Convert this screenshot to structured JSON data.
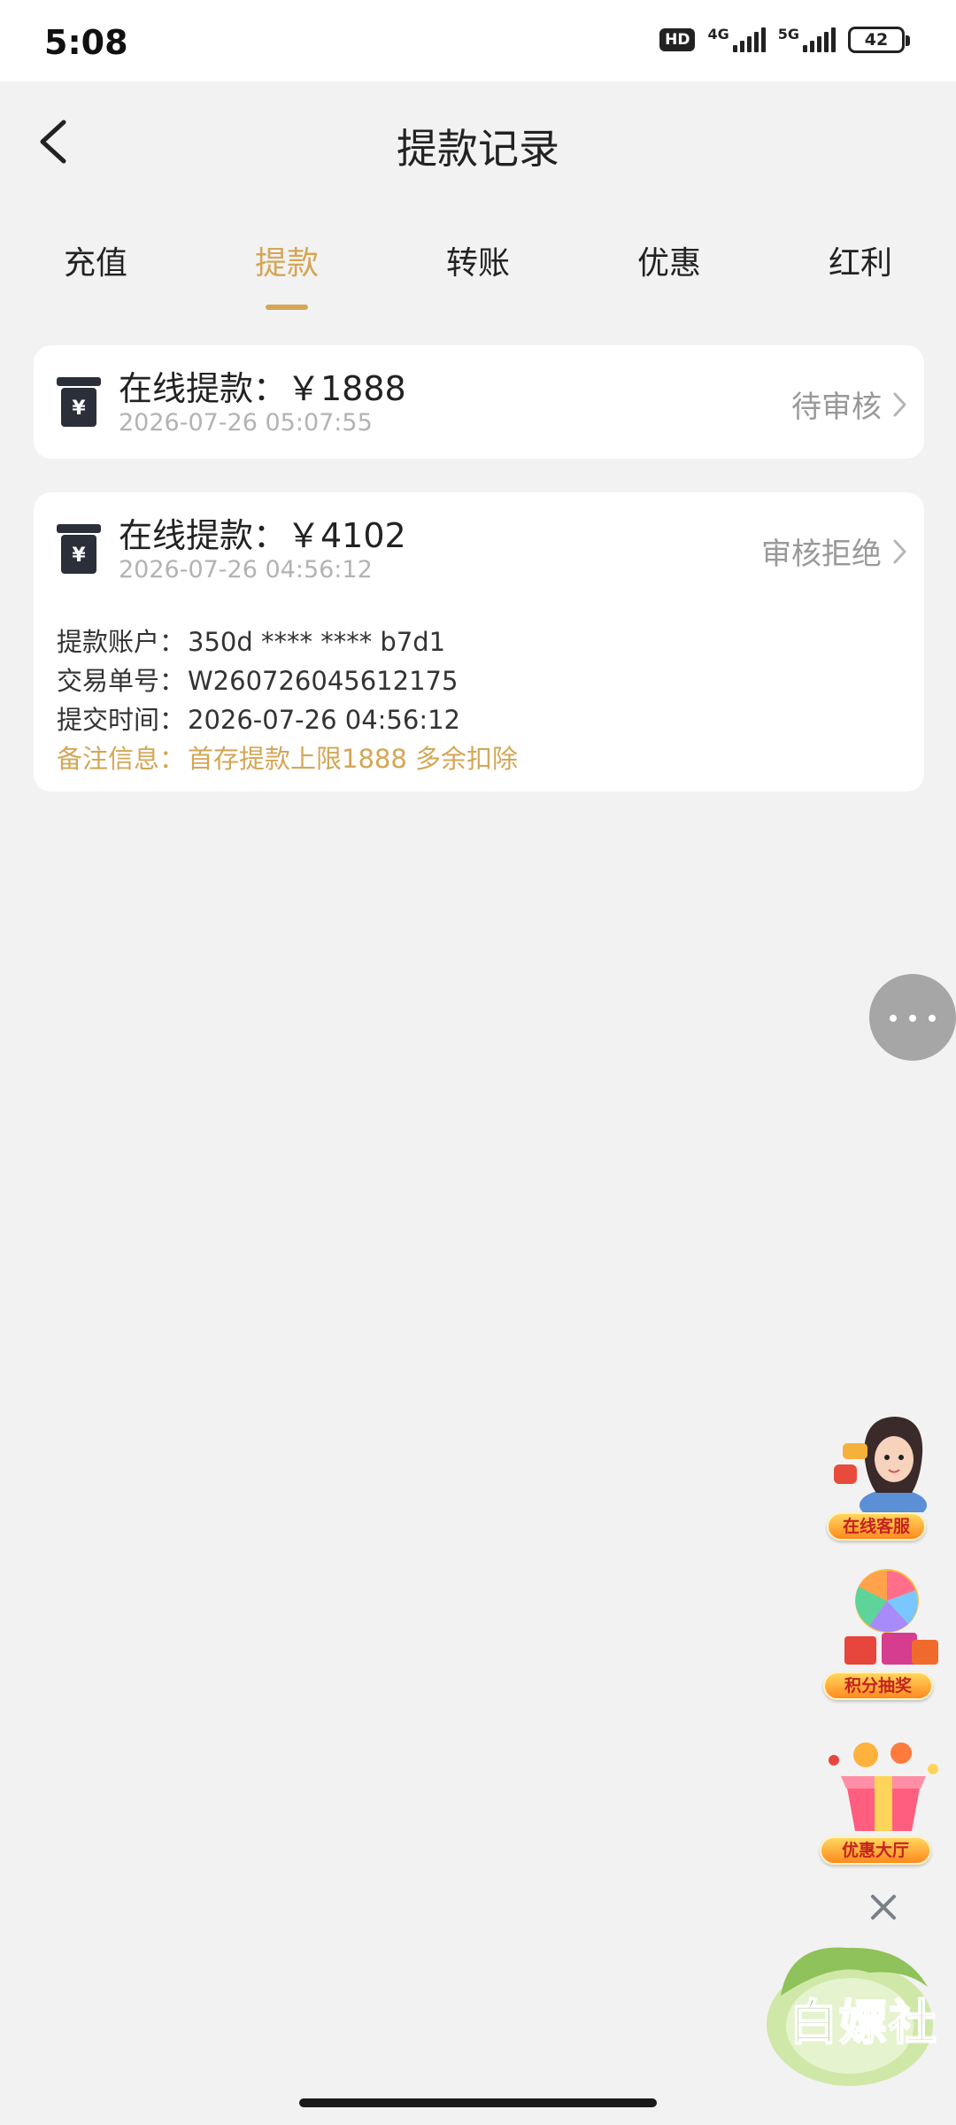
{
  "status_bar": {
    "time": "5:08",
    "hd_badge": "HD",
    "network_1": "4G",
    "network_2": "5G",
    "battery": "42"
  },
  "header": {
    "title": "提款记录",
    "back_icon": "chevron-left-icon"
  },
  "tabs": [
    {
      "label": "充值",
      "active": false
    },
    {
      "label": "提款",
      "active": true
    },
    {
      "label": "转账",
      "active": false
    },
    {
      "label": "优惠",
      "active": false
    },
    {
      "label": "红利",
      "active": false
    }
  ],
  "records": [
    {
      "title": "在线提款：￥1888",
      "date": "2026-07-26 05:07:55",
      "status": "待审核",
      "icon": "atm-yuan-icon"
    },
    {
      "title": "在线提款：￥4102",
      "date": "2026-07-26 04:56:12",
      "status": "审核拒绝",
      "icon": "atm-yuan-icon",
      "details": {
        "account_label": "提款账户：",
        "account_value": "350d **** **** b7d1",
        "order_label": "交易单号：",
        "order_value": "W260726045612175",
        "submit_label": "提交时间：",
        "submit_value": "2026-07-26 04:56:12",
        "note_label": "备注信息：",
        "note_value": "首存提款上限1888 多余扣除"
      }
    }
  ],
  "floating": {
    "more_icon": "more-dots-icon",
    "customer_service": "在线客服",
    "points_lottery": "积分抽奖",
    "promo_hall": "优惠大厅",
    "close_icon": "close-icon"
  },
  "watermark": "白嫖社",
  "colors": {
    "accent": "#d4a656",
    "background": "#f2f2f2",
    "card": "#ffffff",
    "muted": "#999999"
  }
}
